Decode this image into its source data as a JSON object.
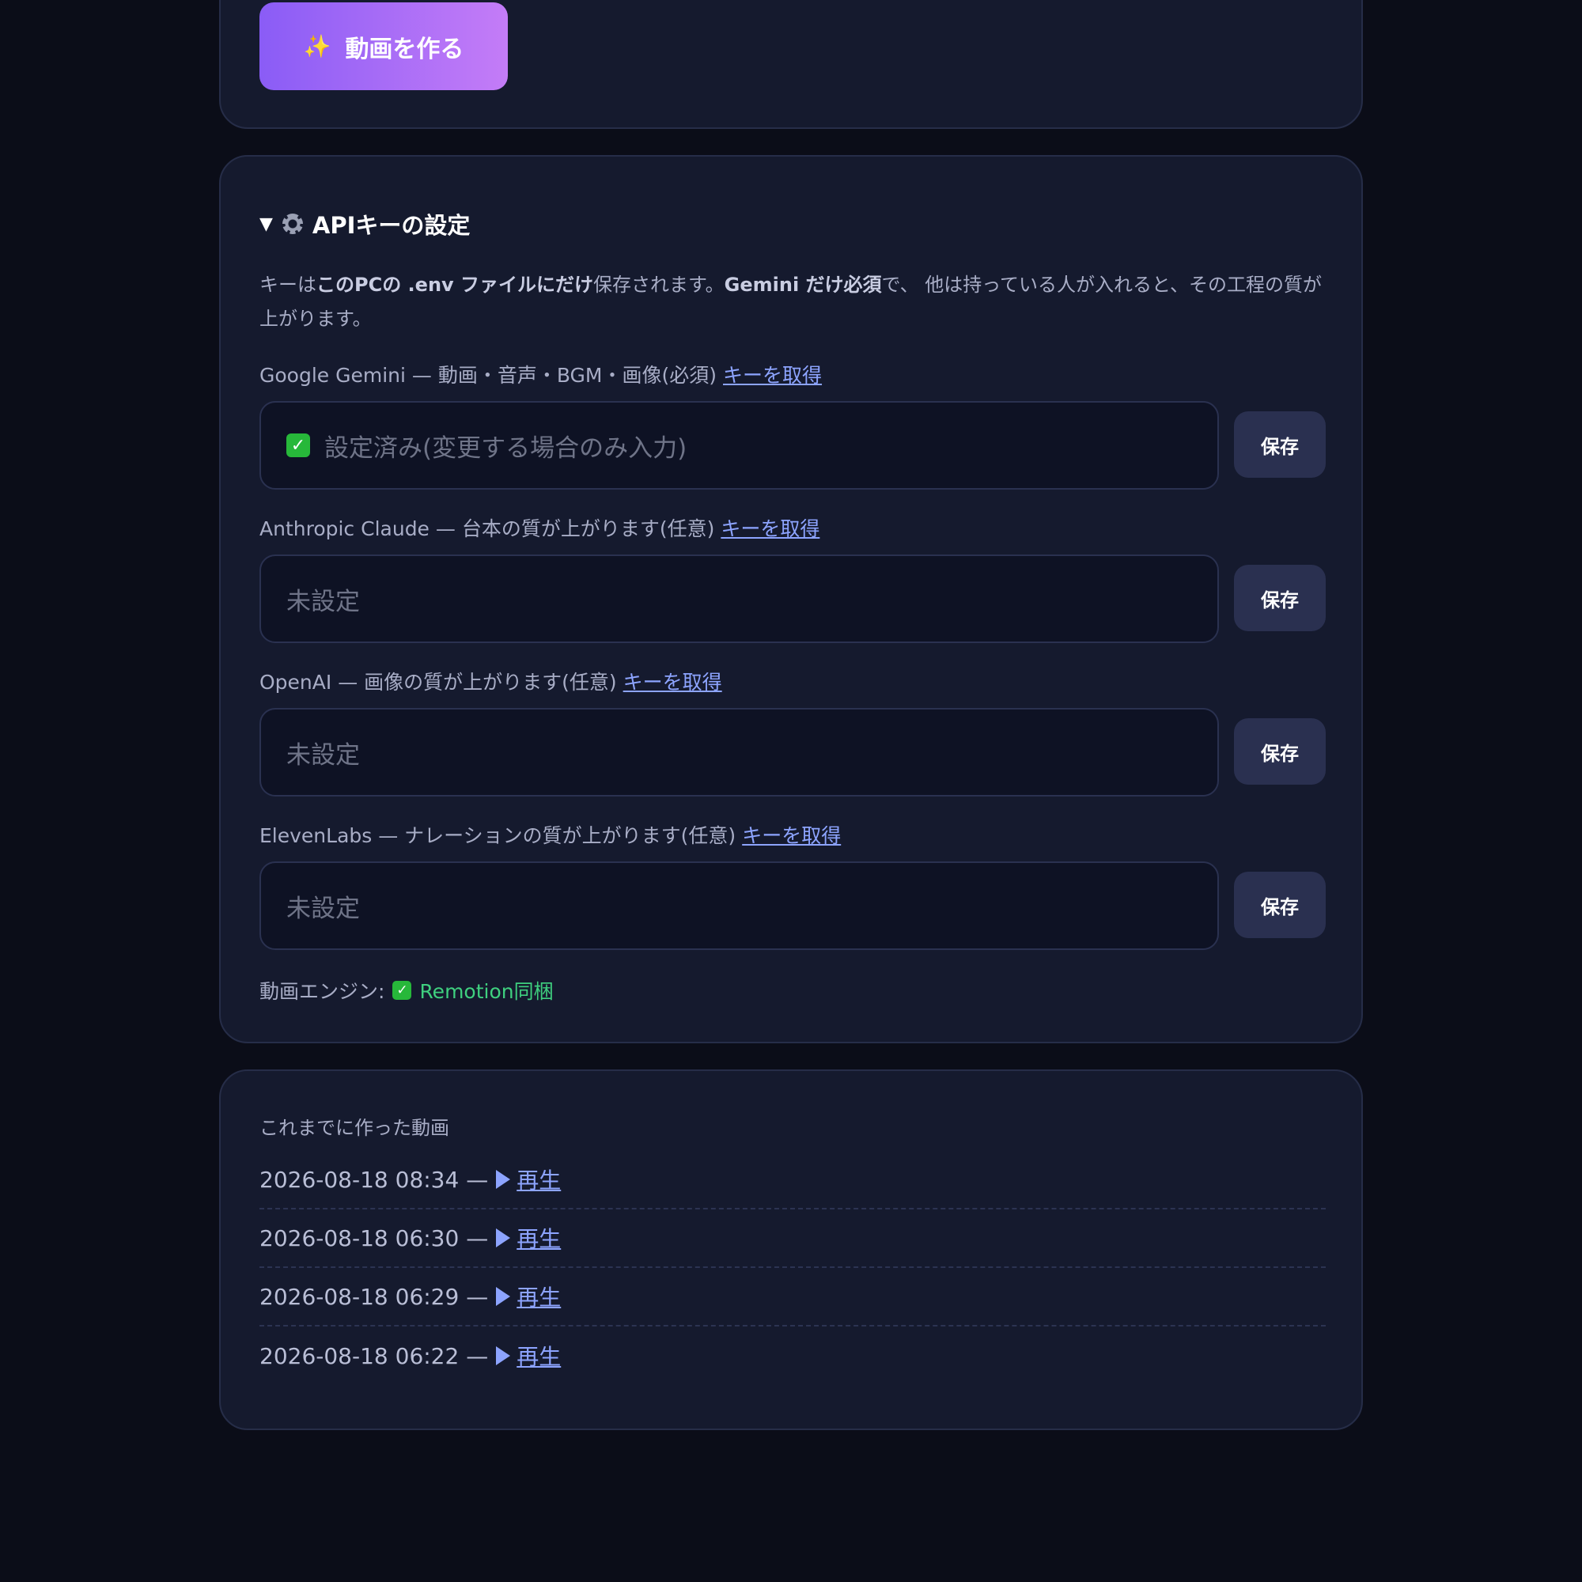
{
  "generate": {
    "button_label": "動画を作る",
    "icon": "sparkles-icon"
  },
  "api_settings": {
    "summary_title": "APIキーの設定",
    "description": {
      "p1": "キーは",
      "b1": "このPCの .env ファイルにだけ",
      "p2": "保存されます。",
      "b2": "Gemini だけ必須",
      "p3": "で、 他は持っている人が入れると、その工程の質が上がります。"
    },
    "keys": [
      {
        "label": "Google Gemini — 動画・音声・BGM・画像(必須)",
        "link": "キーを取得",
        "placeholder": "設定済み(変更する場合のみ入力)",
        "configured": true,
        "save": "保存"
      },
      {
        "label": "Anthropic Claude — 台本の質が上がります(任意)",
        "link": "キーを取得",
        "placeholder": "未設定",
        "configured": false,
        "save": "保存"
      },
      {
        "label": "OpenAI — 画像の質が上がります(任意)",
        "link": "キーを取得",
        "placeholder": "未設定",
        "configured": false,
        "save": "保存"
      },
      {
        "label": "ElevenLabs — ナレーションの質が上がります(任意)",
        "link": "キーを取得",
        "placeholder": "未設定",
        "configured": false,
        "save": "保存"
      }
    ],
    "engine": {
      "label": "動画エンジン:",
      "status": "Remotion同梱"
    }
  },
  "history": {
    "title": "これまでに作った動画",
    "items": [
      {
        "datetime": "2026-08-18 08:34 —",
        "play": "再生"
      },
      {
        "datetime": "2026-08-18 06:30 —",
        "play": "再生"
      },
      {
        "datetime": "2026-08-18 06:29 —",
        "play": "再生"
      },
      {
        "datetime": "2026-08-18 06:22 —",
        "play": "再生"
      }
    ]
  },
  "colors": {
    "accent": "#8a5cf6",
    "link": "#8da4ff",
    "ok": "#3fd07f",
    "background": "#0b0d18",
    "card": "#151a2e"
  }
}
